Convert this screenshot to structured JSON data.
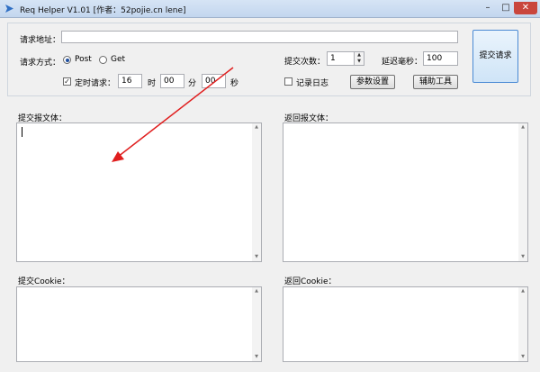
{
  "window": {
    "title": "Req Helper V1.01    [作者：52pojie.cn lene]",
    "minimize": "–",
    "maximize": "□",
    "close": "✕",
    "close_color": "#c9463d"
  },
  "request": {
    "url_label": "请求地址：",
    "url_value": "",
    "method_label": "请求方式：",
    "method_options": [
      "Post",
      "Get"
    ],
    "method_selected": "Post",
    "submit_count_label": "提交次数：",
    "submit_count_value": "1",
    "delay_label": "延迟毫秒：",
    "delay_value": "100",
    "timer_label": "定时请求：",
    "timer_checked": true,
    "hour_value": "16",
    "hour_unit": "时",
    "minute_value": "00",
    "minute_unit": "分",
    "second_value": "00",
    "second_unit": "秒",
    "log_label": "记录日志",
    "log_checked": false,
    "params_button": "参数设置",
    "tools_button": "辅助工具",
    "submit_button": "提交请求"
  },
  "panels": {
    "request_body_label": "提交报文体：",
    "response_body_label": "返回报文体：",
    "request_cookie_label": "提交Cookie：",
    "response_cookie_label": "返回Cookie："
  },
  "annotation": {
    "arrow_color": "#e01e1e"
  }
}
